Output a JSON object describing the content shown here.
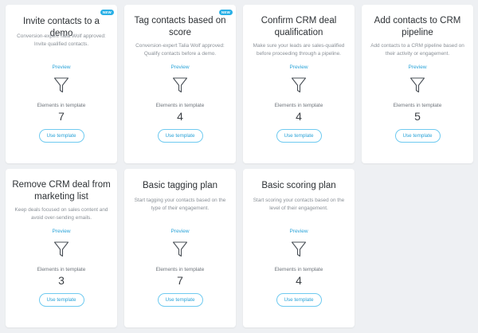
{
  "templates": [
    {
      "title": "Invite contacts to a demo",
      "badge": "NEW",
      "description": "Conversion-expert Talia Wolf approved: Invite qualified contacts.",
      "preview_label": "Preview",
      "elements_label": "Elements in template",
      "elements_count": "7",
      "button_label": "Use template",
      "icon": "funnel-icon"
    },
    {
      "title": "Tag contacts based on score",
      "badge": "NEW",
      "description": "Conversion-expert Talia Wolf approved: Qualify contacts before a demo.",
      "preview_label": "Preview",
      "elements_label": "Elements in template",
      "elements_count": "4",
      "button_label": "Use template",
      "icon": "funnel-icon"
    },
    {
      "title": "Confirm CRM deal qualification",
      "badge": "",
      "description": "Make sure your leads are sales-qualified before proceeding through a pipeline.",
      "preview_label": "Preview",
      "elements_label": "Elements in template",
      "elements_count": "4",
      "button_label": "Use template",
      "icon": "funnel-icon"
    },
    {
      "title": "Add contacts to CRM pipeline",
      "badge": "",
      "description": "Add contacts to a CRM pipeline based on their activity or engagement.",
      "preview_label": "Preview",
      "elements_label": "Elements in template",
      "elements_count": "5",
      "button_label": "Use template",
      "icon": "funnel-icon"
    },
    {
      "title": "Remove CRM deal from marketing list",
      "badge": "",
      "description": "Keep deals focused on sales content and avoid over-sending emails.",
      "preview_label": "Preview",
      "elements_label": "Elements in template",
      "elements_count": "3",
      "button_label": "Use template",
      "icon": "funnel-icon"
    },
    {
      "title": "Basic tagging plan",
      "badge": "",
      "description": "Start tagging your contacts based on the type of their engagement.",
      "preview_label": "Preview",
      "elements_label": "Elements in template",
      "elements_count": "7",
      "button_label": "Use template",
      "icon": "funnel-icon"
    },
    {
      "title": "Basic scoring plan",
      "badge": "",
      "description": "Start scoring your contacts based on the level of their engagement.",
      "preview_label": "Preview",
      "elements_label": "Elements in template",
      "elements_count": "4",
      "button_label": "Use template",
      "icon": "funnel-icon"
    }
  ],
  "colors": {
    "background": "#eef0f3",
    "card": "#ffffff",
    "accent": "#2aa3d8",
    "badge": "#2ab0e6"
  }
}
